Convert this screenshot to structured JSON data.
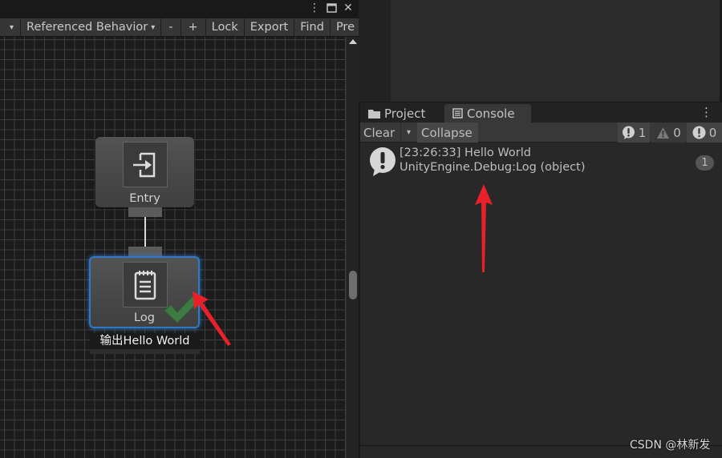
{
  "behavior_window": {
    "window_controls": {
      "more": "⋮",
      "maximize": "□",
      "close": "✕"
    },
    "toolbar": {
      "menu_caret": "▾",
      "referenced_behavior": "Referenced Behavior",
      "referenced_caret": "▾",
      "minus": "-",
      "plus": "+",
      "lock": "Lock",
      "export": "Export",
      "find": "Find",
      "preferences": "Pre"
    },
    "graph": {
      "nodes": [
        {
          "id": "entry",
          "label": "Entry",
          "icon": "entry-icon"
        },
        {
          "id": "log",
          "label": "Log",
          "icon": "notepad-icon",
          "comment": "输出Hello World",
          "status": "success",
          "selected": true
        }
      ]
    }
  },
  "console_window": {
    "tabs": [
      {
        "label": "Project",
        "icon": "folder-icon",
        "active": false
      },
      {
        "label": "Console",
        "icon": "console-icon",
        "active": true
      }
    ],
    "more": "⋮",
    "toolbar": {
      "clear": "Clear",
      "clear_caret": "▾",
      "collapse": "Collapse",
      "log_count": "1",
      "warning_count": "0",
      "error_count": "0"
    },
    "entries": [
      {
        "line1": "[23:26:33] Hello World",
        "line2": "UnityEngine.Debug:Log (object)",
        "count": "1",
        "type": "log"
      }
    ]
  },
  "watermark": "CSDN @林新发",
  "colors": {
    "selection_blue": "#2f79c6",
    "success_green": "#3e7a44",
    "annotation_red": "#e8202a"
  }
}
